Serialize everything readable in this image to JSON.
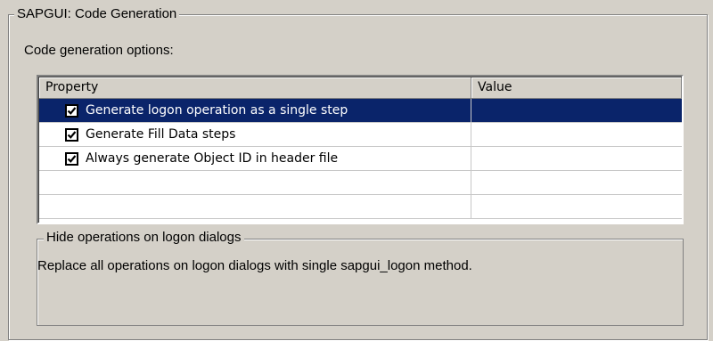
{
  "group": {
    "title": "SAPGUI: Code Generation"
  },
  "options_label": "Code generation options:",
  "grid": {
    "columns": [
      "Property",
      "Value"
    ],
    "rows": [
      {
        "label": "Generate logon operation as a single step",
        "checked": true,
        "value": "",
        "selected": true
      },
      {
        "label": "Generate Fill Data steps",
        "checked": true,
        "value": "",
        "selected": false
      },
      {
        "label": "Always generate Object ID in header file",
        "checked": true,
        "value": "",
        "selected": false
      },
      {
        "label": "",
        "checked": false,
        "value": "",
        "selected": false
      },
      {
        "label": "",
        "checked": false,
        "value": "",
        "selected": false
      }
    ]
  },
  "hint": {
    "title": "Hide operations on logon dialogs",
    "text": "Replace all operations on logon dialogs with single sapgui_logon method."
  },
  "colors": {
    "selection": "#0a246a",
    "background": "#d4d0c8"
  }
}
